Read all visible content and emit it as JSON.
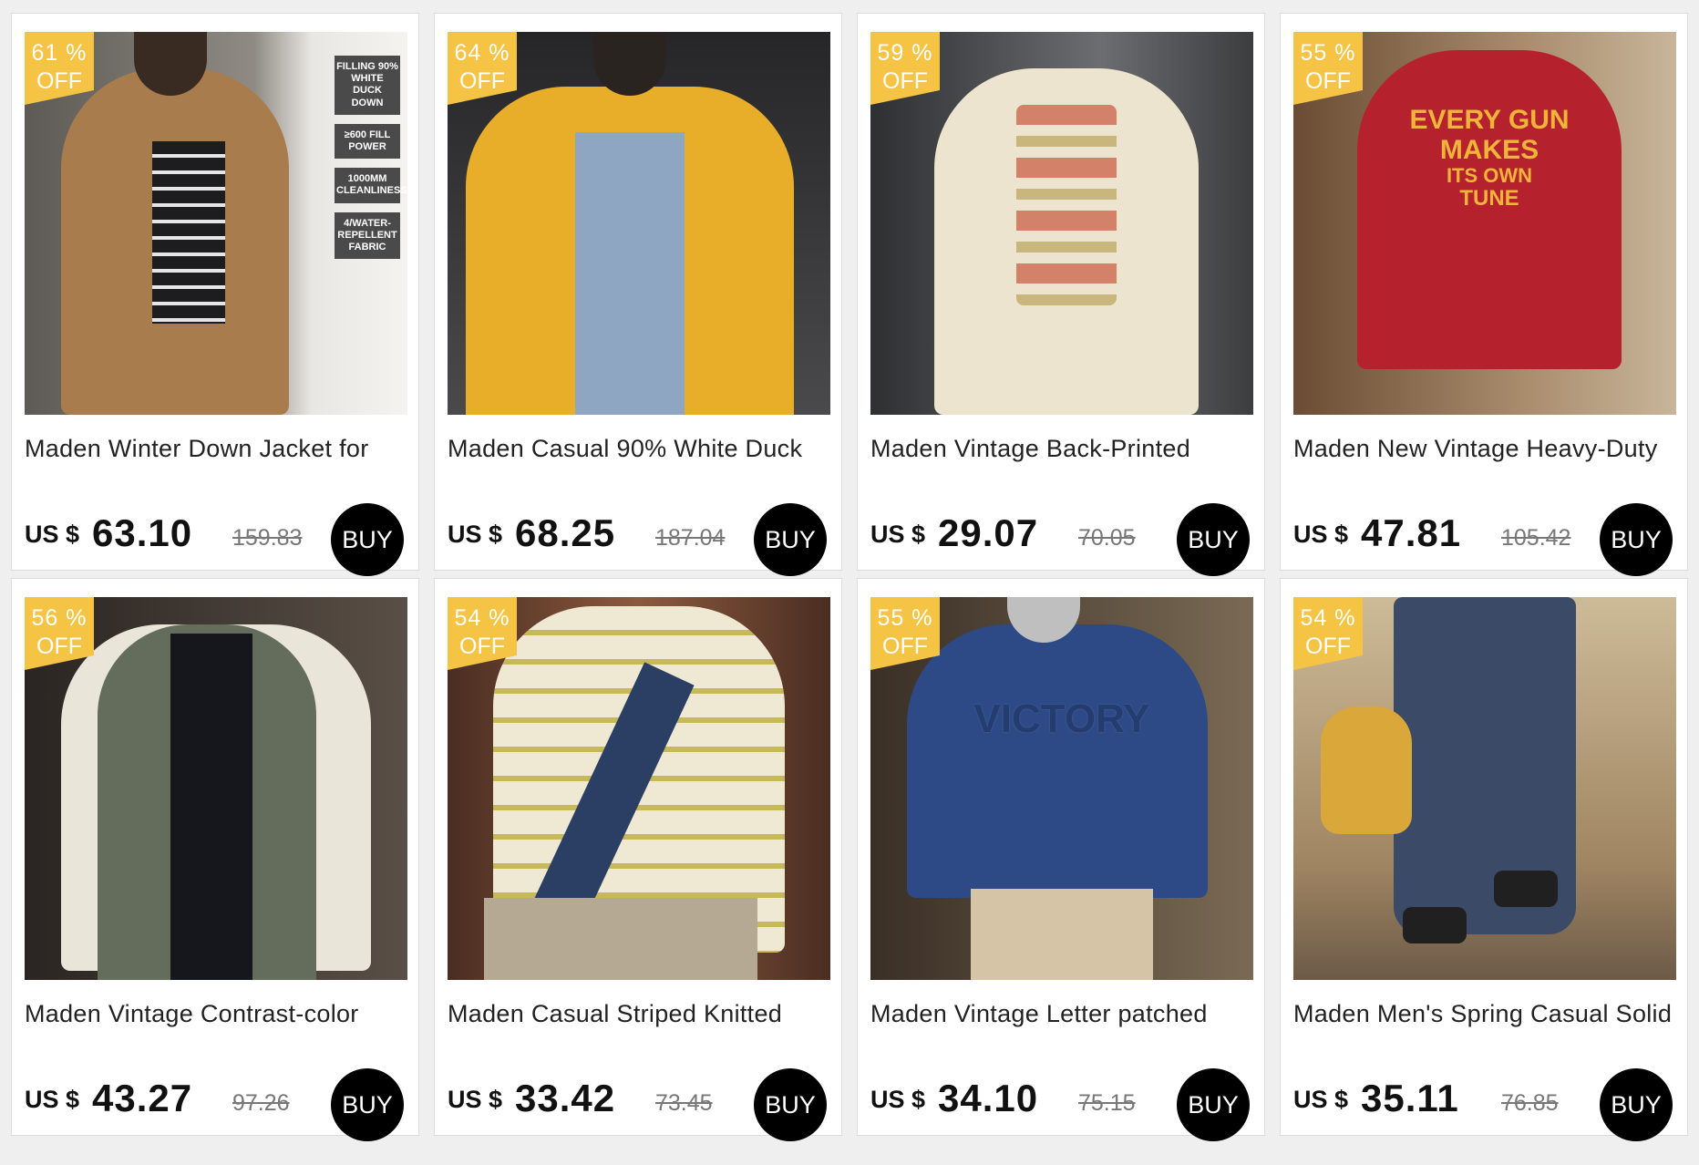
{
  "products": [
    {
      "discount_pct": "61 %",
      "off": "OFF",
      "title": "Maden Winter Down Jacket for",
      "currency": "US $",
      "price": "63.10",
      "original": "159.83",
      "buy": "BUY",
      "colors": {
        "bg": "#d8d6d2",
        "garment": "#a97c4e"
      }
    },
    {
      "discount_pct": "64 %",
      "off": "OFF",
      "title": "Maden Casual 90% White Duck",
      "currency": "US $",
      "price": "68.25",
      "original": "187.04",
      "buy": "BUY",
      "colors": {
        "bg": "#3a3a3c",
        "garment": "#e8ae2a"
      }
    },
    {
      "discount_pct": "59 %",
      "off": "OFF",
      "title": "Maden Vintage Back-Printed",
      "currency": "US $",
      "price": "29.07",
      "original": "70.05",
      "buy": "BUY",
      "colors": {
        "bg": "#4e4f52",
        "garment": "#ece4cf"
      }
    },
    {
      "discount_pct": "55 %",
      "off": "OFF",
      "title": "Maden New Vintage Heavy-Duty",
      "currency": "US $",
      "price": "47.81",
      "original": "105.42",
      "buy": "BUY",
      "colors": {
        "bg": "#8a6a4c",
        "garment": "#b5222d"
      }
    },
    {
      "discount_pct": "56 %",
      "off": "OFF",
      "title": "Maden Vintage Contrast-color",
      "currency": "US $",
      "price": "43.27",
      "original": "97.26",
      "buy": "BUY",
      "colors": {
        "bg": "#3a3430",
        "garment": "#646d5c"
      }
    },
    {
      "discount_pct": "54 %",
      "off": "OFF",
      "title": "Maden Casual Striped Knitted",
      "currency": "US $",
      "price": "33.42",
      "original": "73.45",
      "buy": "BUY",
      "colors": {
        "bg": "#6a4332",
        "garment": "#efe9d4"
      }
    },
    {
      "discount_pct": "55 %",
      "off": "OFF",
      "title": "Maden Vintage Letter patched",
      "currency": "US $",
      "price": "34.10",
      "original": "75.15",
      "buy": "BUY",
      "colors": {
        "bg": "#5a4a3c",
        "garment": "#2d4a86"
      }
    },
    {
      "discount_pct": "54 %",
      "off": "OFF",
      "title": "Maden Men's Spring Casual Solid",
      "currency": "US $",
      "price": "35.11",
      "original": "76.85",
      "buy": "BUY",
      "colors": {
        "bg": "#b09a74",
        "garment": "#3b4a66"
      }
    }
  ],
  "product1_spec": [
    "FILLING 90% WHITE DUCK DOWN",
    "≥600 FILL POWER",
    "1000MM CLEANLINESS",
    "4/WATER-REPELLENT FABRIC"
  ],
  "product4_print": [
    "EVERY GUN",
    "MAKES",
    "ITS OWN",
    "TUNE"
  ],
  "product7_print": "VICTORY",
  "badge_color": "#f6c445"
}
